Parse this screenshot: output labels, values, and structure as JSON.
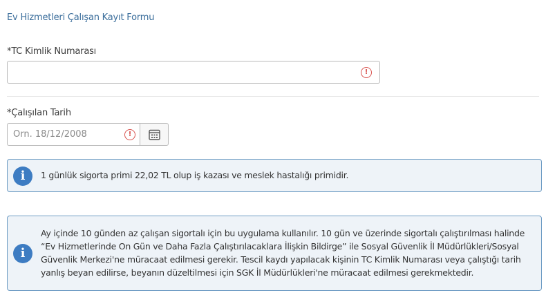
{
  "form": {
    "title": "Ev Hizmetleri Çalışan Kayıt Formu"
  },
  "tc_field": {
    "required_mark": "*",
    "label": "TC Kimlik Numarası",
    "value": "",
    "error_icon": "exclamation-circle-icon"
  },
  "date_field": {
    "required_mark": "*",
    "label": "Çalışılan Tarih",
    "placeholder": "Örn. 18/12/2008",
    "value": "",
    "error_icon": "exclamation-circle-icon",
    "calendar_icon": "calendar-icon"
  },
  "info_short": {
    "icon": "info-icon",
    "text": "1 günlük sigorta primi 22,02 TL olup iş kazası ve meslek hastalığı primidir."
  },
  "info_long": {
    "icon": "info-icon",
    "text": "Ay içinde 10 günden az çalışan sigortalı için bu uygulama kullanılır. 10 gün ve üzerinde sigortalı çalıştırılması halinde “Ev Hizmetlerinde On Gün ve Daha Fazla Çalıştırılacaklara İlişkin Bildirge” ile Sosyal Güvenlik İl Müdürlükleri/Sosyal Güvenlik Merkezi'ne müracaat edilmesi gerekir. Tescil kaydı yapılacak kişinin TC Kimlik Numarası veya çalıştığı tarih yanlış beyan edilirse, beyanın düzeltilmesi için SGK İl Müdürlükleri'ne müracaat edilmesi gerekmektedir."
  },
  "colors": {
    "title": "#3a6d9b",
    "error": "#d9534f",
    "info_bg": "#eef3f8",
    "info_border": "#6e9cc4",
    "info_icon": "#3d7cc2"
  }
}
